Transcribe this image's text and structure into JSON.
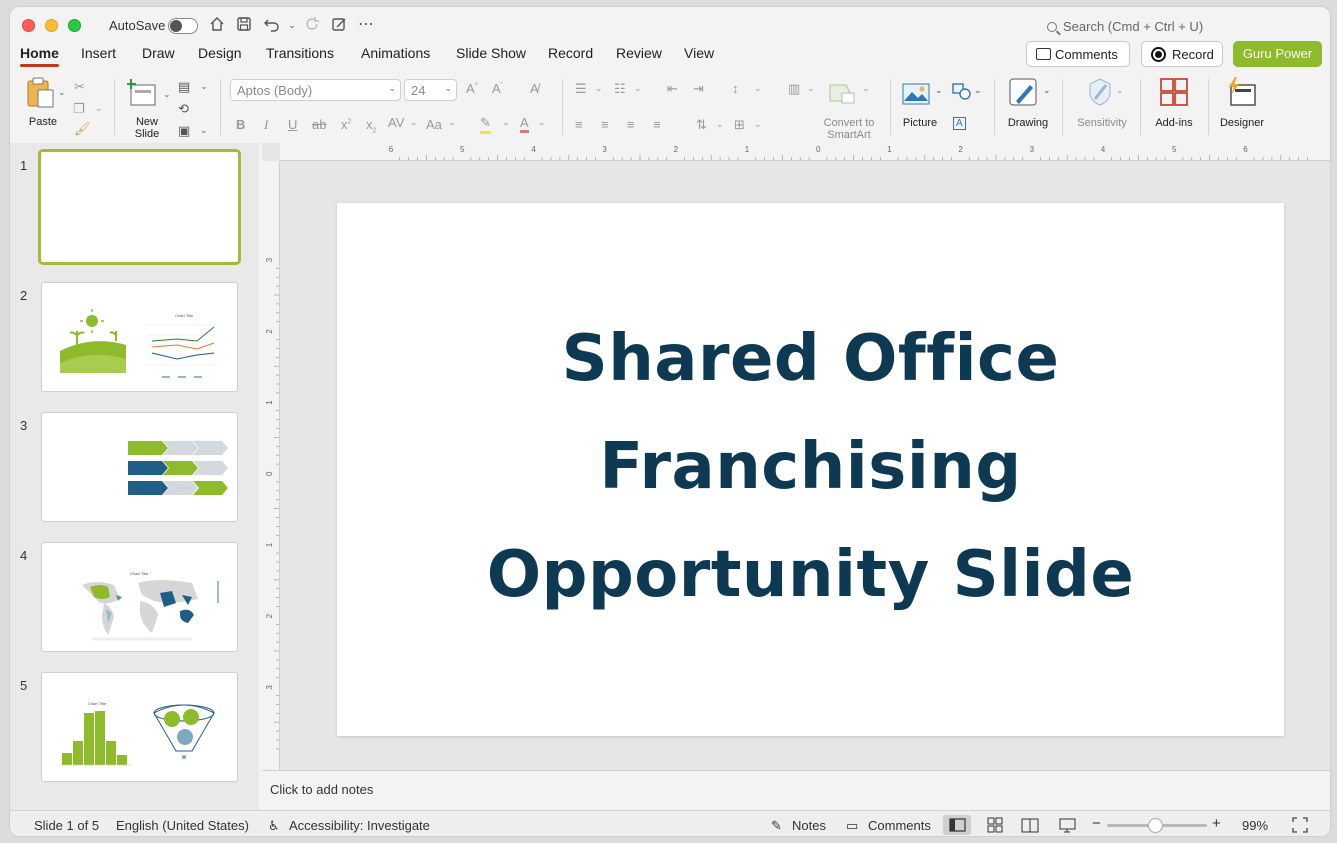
{
  "titlebar": {
    "autosave_label": "AutoSave",
    "search_placeholder": "Search (Cmd + Ctrl + U)"
  },
  "tabs": [
    {
      "label": "Home",
      "active": true
    },
    {
      "label": "Insert"
    },
    {
      "label": "Draw"
    },
    {
      "label": "Design"
    },
    {
      "label": "Transitions"
    },
    {
      "label": "Animations"
    },
    {
      "label": "Slide Show"
    },
    {
      "label": "Record"
    },
    {
      "label": "Review"
    },
    {
      "label": "View"
    }
  ],
  "header_buttons": {
    "comments": "Comments",
    "record": "Record",
    "guru": "Guru Power",
    "guru_color": "#8dbb2c"
  },
  "ribbon": {
    "paste": "Paste",
    "new_slide_1": "New",
    "new_slide_2": "Slide",
    "font_name": "Aptos (Body)",
    "font_size": "24",
    "convert_1": "Convert to",
    "convert_2": "SmartArt",
    "picture": "Picture",
    "drawing": "Drawing",
    "sensitivity": "Sensitivity",
    "addins": "Add-ins",
    "designer": "Designer"
  },
  "thumbnails": [
    {
      "num": "1"
    },
    {
      "num": "2"
    },
    {
      "num": "3"
    },
    {
      "num": "4"
    },
    {
      "num": "5"
    }
  ],
  "slide": {
    "title_lines": [
      "Shared Office",
      "Franchising",
      "Opportunity Slide"
    ],
    "title_color": "#0d3a52"
  },
  "notes_placeholder": "Click to add notes",
  "status": {
    "slide_info": "Slide 1 of 5",
    "language": "English (United States)",
    "accessibility": "Accessibility: Investigate",
    "notes": "Notes",
    "comments": "Comments",
    "zoom": "99%"
  },
  "ruler": {
    "h_labels": [
      "6",
      "5",
      "4",
      "3",
      "2",
      "1",
      "0",
      "1",
      "2",
      "3",
      "4",
      "5",
      "6"
    ],
    "v_labels": [
      "3",
      "2",
      "1",
      "0",
      "1",
      "2",
      "3"
    ]
  }
}
